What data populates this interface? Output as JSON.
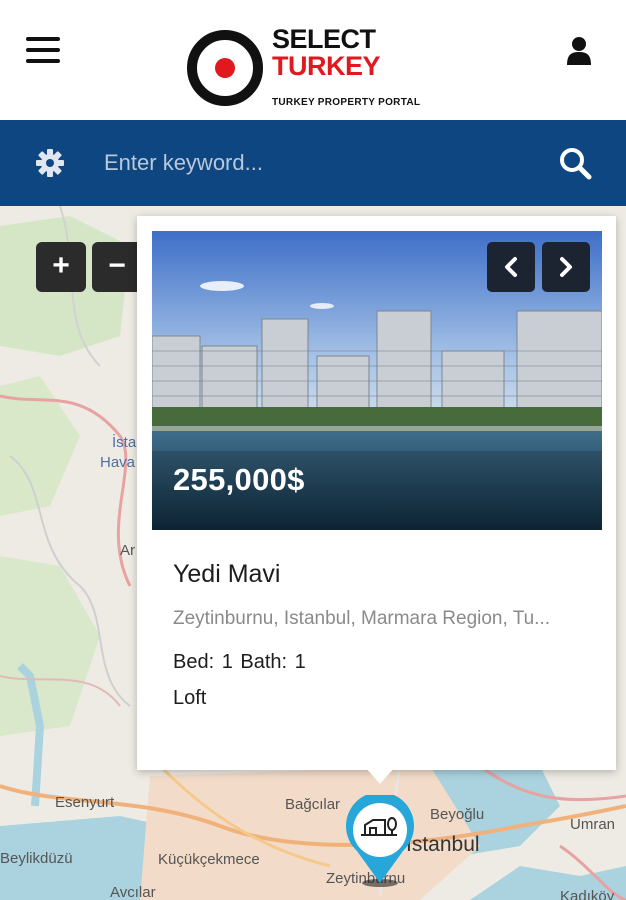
{
  "header": {
    "brand_line1": "SELECT",
    "brand_line2": "TURKEY",
    "brand_tagline": "TURKEY PROPERTY PORTAL",
    "menu_icon": "hamburger-icon",
    "user_icon": "user-icon"
  },
  "search": {
    "placeholder": "Enter keyword...",
    "settings_icon": "gear-icon",
    "search_icon": "search-icon",
    "bar_color": "#0d4680"
  },
  "map": {
    "zoom_in": "+",
    "zoom_out": "−",
    "labels": {
      "istanbul_airport_1": "İsta",
      "istanbul_airport_2": "Hava",
      "arnavutkoy": "Ar",
      "esenyurt": "Esenyurt",
      "bagcilar": "Bağcılar",
      "beyoglu": "Beyoğlu",
      "umraniye": "Umran",
      "beylikduzu": "Beylikdüzü",
      "kucukcekmece": "Küçükçekmece",
      "istanbul": "İstanbul",
      "zeytinburnu": "Zeytinburnu",
      "avcilar": "Avcılar",
      "kadikoy": "Kadıköy"
    }
  },
  "listing": {
    "price": "255,000$",
    "title": "Yedi Mavi",
    "address": "Zeytinburnu, Istanbul, Marmara Region, Tu...",
    "beds_baths": "Bed: 1   Bath: 1",
    "type": "Loft",
    "prev_icon": "chevron-left-icon",
    "next_icon": "chevron-right-icon"
  },
  "colors": {
    "brand_red": "#e0191f",
    "pin_blue": "#27a7d9"
  }
}
